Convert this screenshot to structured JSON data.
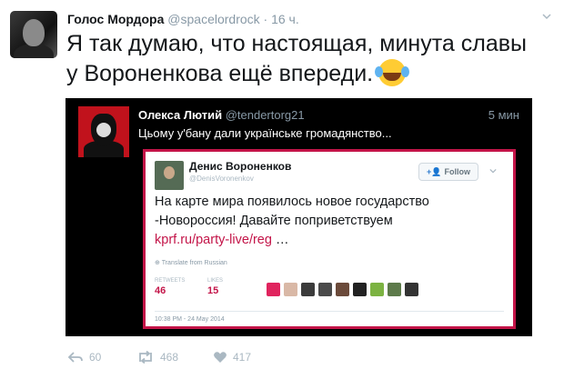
{
  "tweet": {
    "author_name": "Голос Мордора",
    "author_handle": "@spacelordrock",
    "time": "· 16 ч.",
    "text": "Я так думаю, что настоящая, минута славы у Вороненкова ещё впереди.",
    "emoji": "face-with-tears-of-joy-icon"
  },
  "embedded": {
    "author_name": "Олекса Лютий",
    "author_handle": "@tendertorg21",
    "time": "5 мин",
    "text": "Цьому у'бану дали українське громадянство...",
    "card": {
      "author_name": "Денис Вороненков",
      "author_handle": "@DenisVoronenkov",
      "follow_label": "Follow",
      "text_line1": "На карте мира появилось новое государство",
      "text_line2": "-Новороссия! Давайте поприветствуем",
      "link": "kprf.ru/party-live/reg",
      "link_suffix": " …",
      "translate": "Translate from Russian",
      "retweets_label": "RETWEETS",
      "retweets": "46",
      "likes_label": "LIKES",
      "likes": "15",
      "date": "10:38 PM - 24 May 2014"
    }
  },
  "actions": {
    "replies": "60",
    "retweets": "468",
    "likes": "417"
  },
  "colors": {
    "text": "#14171a",
    "muted": "#8899a6",
    "accent": "#c31448",
    "embed_bg": "#000000"
  }
}
